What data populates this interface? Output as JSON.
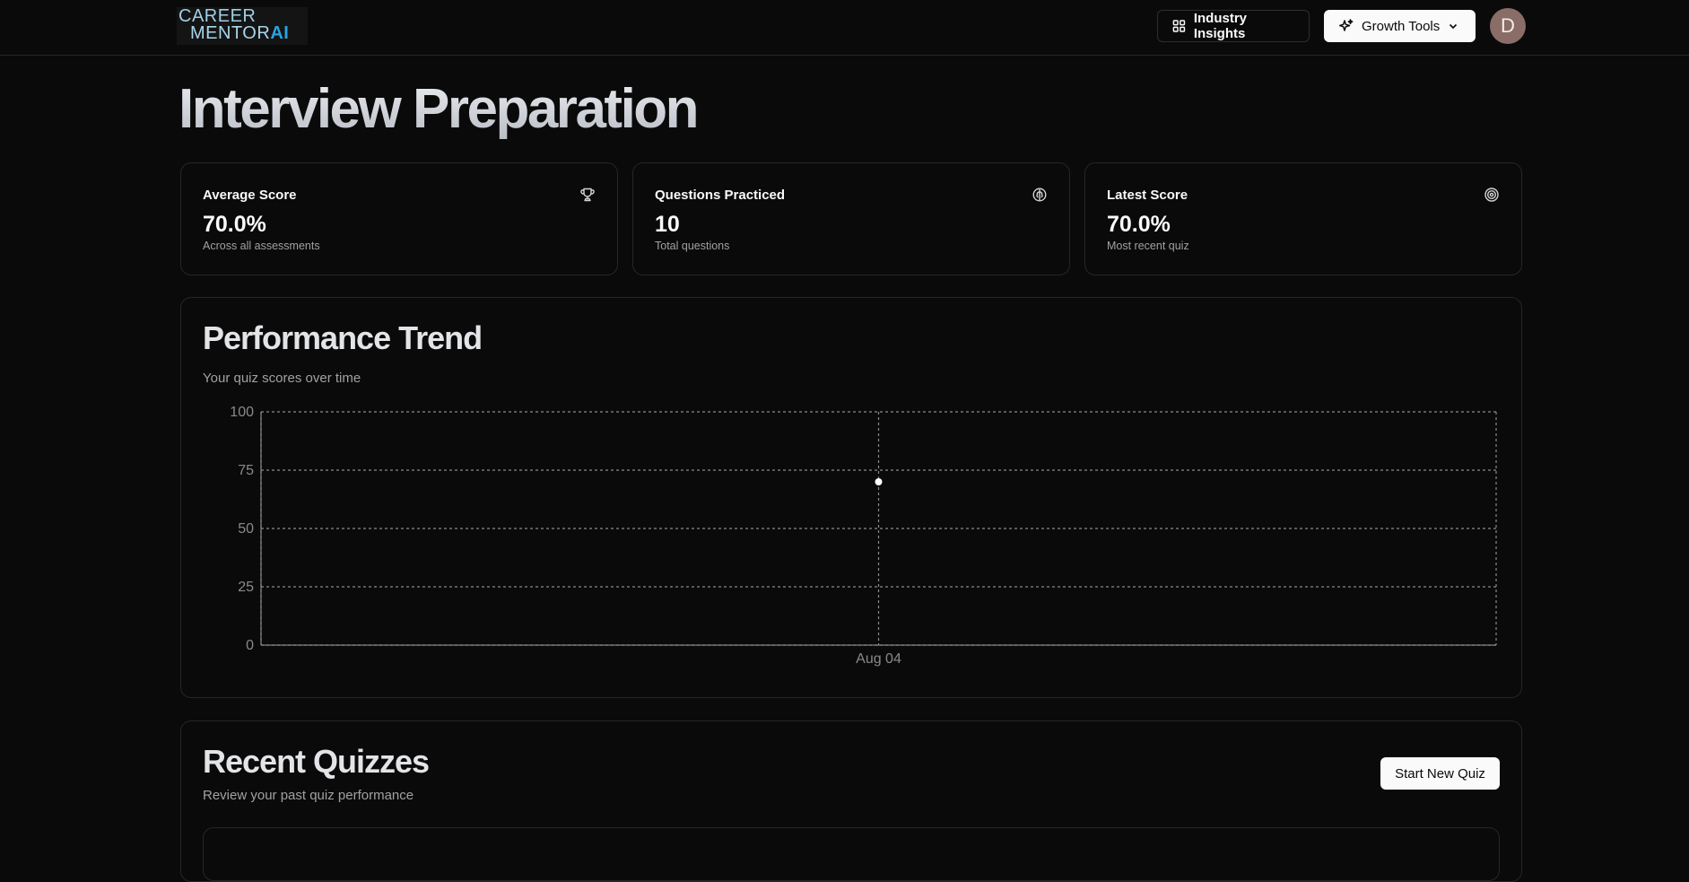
{
  "header": {
    "logo": {
      "line1": "CAREER",
      "line2": "MENTOR",
      "ai": "AI"
    },
    "industry_insights_label": "Industry Insights",
    "growth_tools_label": "Growth Tools",
    "avatar_letter": "D"
  },
  "page": {
    "title": "Interview Preparation"
  },
  "stats": [
    {
      "label": "Average Score",
      "value": "70.0%",
      "sub": "Across all assessments",
      "icon": "trophy-icon"
    },
    {
      "label": "Questions Practiced",
      "value": "10",
      "sub": "Total questions",
      "icon": "brain-icon"
    },
    {
      "label": "Latest Score",
      "value": "70.0%",
      "sub": "Most recent quiz",
      "icon": "target-icon"
    }
  ],
  "performance": {
    "title": "Performance Trend",
    "subtitle": "Your quiz scores over time"
  },
  "chart_data": {
    "type": "line",
    "categories": [
      "Aug 04"
    ],
    "values": [
      70
    ],
    "ylim": [
      0,
      100
    ],
    "yticks": [
      0,
      25,
      50,
      75,
      100
    ],
    "grid": true,
    "colors": {
      "point": "#ffffff",
      "grid": "#8a8a8a",
      "tick_text": "#8a8a8a"
    }
  },
  "recent": {
    "title": "Recent Quizzes",
    "subtitle": "Review your past quiz performance",
    "start_button_label": "Start New Quiz"
  }
}
